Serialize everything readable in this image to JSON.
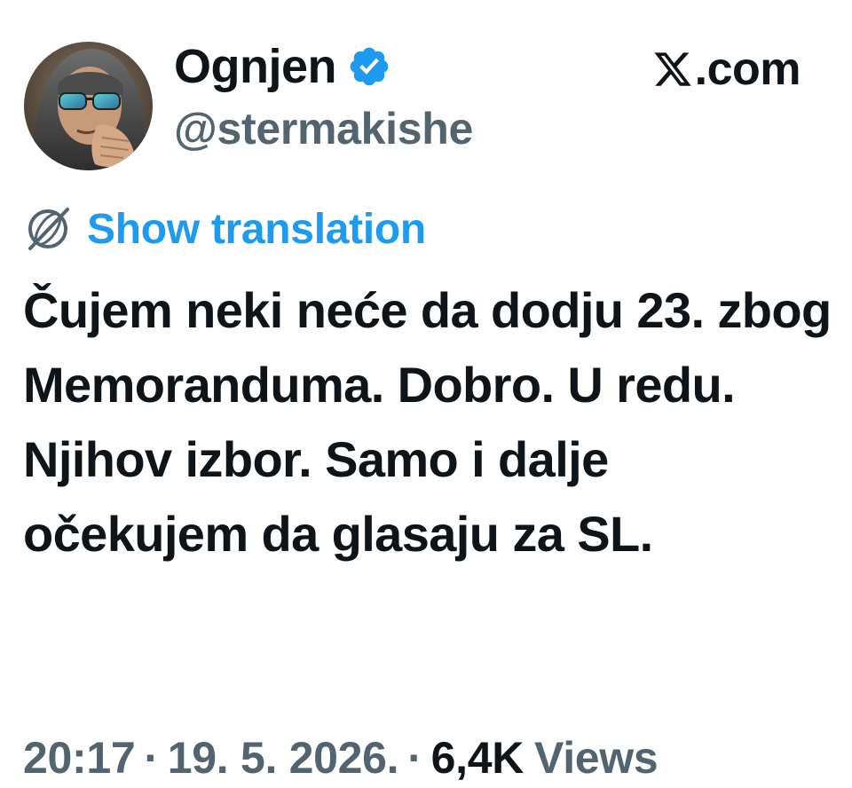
{
  "author": {
    "display_name": "Ognjen",
    "handle": "@stermakishe",
    "verified": true
  },
  "brand": {
    "text": ".com",
    "icon": "x-logo-icon"
  },
  "translation": {
    "label": "Show translation",
    "icon": "globe-icon"
  },
  "tweet": {
    "text": "Čujem neki neće da dodju 23. zbog Memoranduma. Dobro. U redu. Njihov izbor. Samo i dalje očekujem da glasaju za SL."
  },
  "meta": {
    "time": "20:17",
    "separator": "·",
    "date": "19. 5. 2026.",
    "views_count": "6,4K",
    "views_label": "Views"
  },
  "colors": {
    "link": "#1d9bf0",
    "verified_badge": "#1d9bf0",
    "secondary_text": "#536471",
    "primary_text": "#0f1419"
  }
}
